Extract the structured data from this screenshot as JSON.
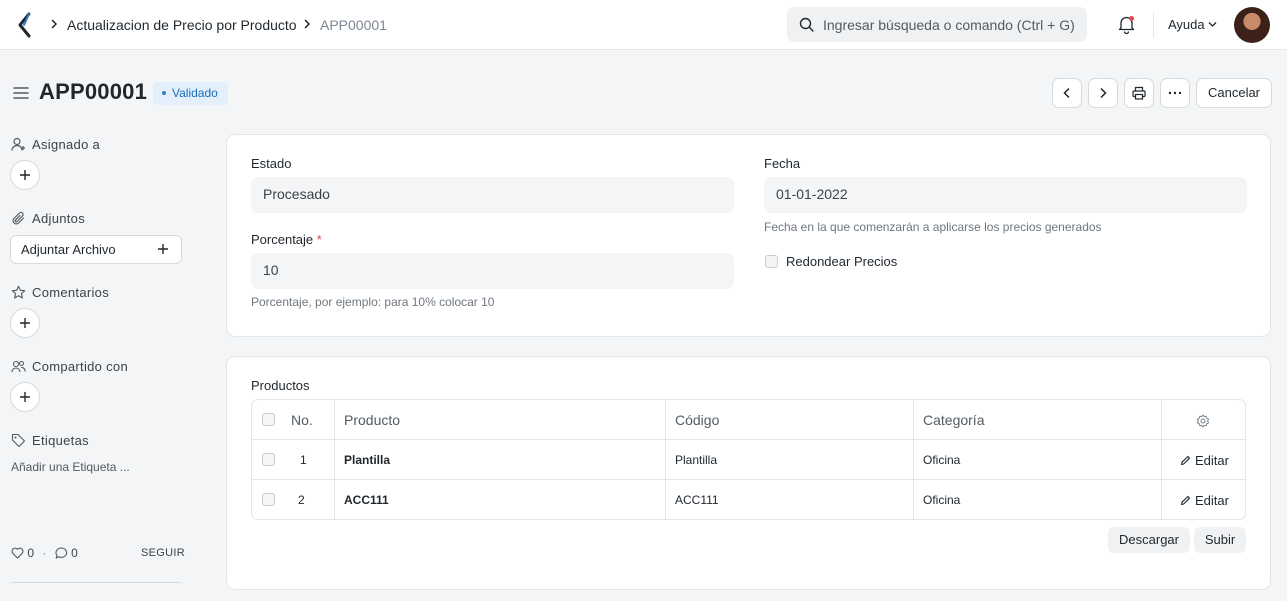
{
  "navbar": {
    "breadcrumbs": [
      "Actualizacion de Precio por Producto",
      "APP00001"
    ],
    "search_placeholder": "Ingresar búsqueda o comando (Ctrl + G)",
    "help_label": "Ayuda"
  },
  "header": {
    "title": "APP00001",
    "status": "Validado",
    "cancel_label": "Cancelar"
  },
  "sidebar": {
    "assigned_label": "Asignado a",
    "attachments_label": "Adjuntos",
    "attach_button": "Adjuntar Archivo",
    "comments_label": "Comentarios",
    "shared_label": "Compartido con",
    "tags_label": "Etiquetas",
    "add_tag": "Añadir una Etiqueta ...",
    "likes": "0",
    "comments_count": "0",
    "follow_label": "SEGUIR"
  },
  "form": {
    "estado_label": "Estado",
    "estado_value": "Procesado",
    "fecha_label": "Fecha",
    "fecha_value": "01-01-2022",
    "fecha_help": "Fecha en la que comenzarán a aplicarse los precios generados",
    "porcentaje_label": "Porcentaje",
    "porcentaje_required": "*",
    "porcentaje_value": "10",
    "porcentaje_help": "Porcentaje, por ejemplo: para 10% colocar 10",
    "redondear_label": "Redondear Precios"
  },
  "productos": {
    "section_label": "Productos",
    "columns": [
      "No.",
      "Producto",
      "Código",
      "Categoría"
    ],
    "rows": [
      {
        "no": "1",
        "producto": "Plantilla",
        "codigo": "Plantilla",
        "categoria": "Oficina",
        "edit": "Editar"
      },
      {
        "no": "2",
        "producto": "ACC111",
        "codigo": "ACC111",
        "categoria": "Oficina",
        "edit": "Editar"
      }
    ],
    "download_label": "Descargar",
    "upload_label": "Subir"
  },
  "colors": {
    "badge_bg": "#e3f0fb",
    "badge_text": "#1b6cb6",
    "required": "#e24c4c"
  }
}
